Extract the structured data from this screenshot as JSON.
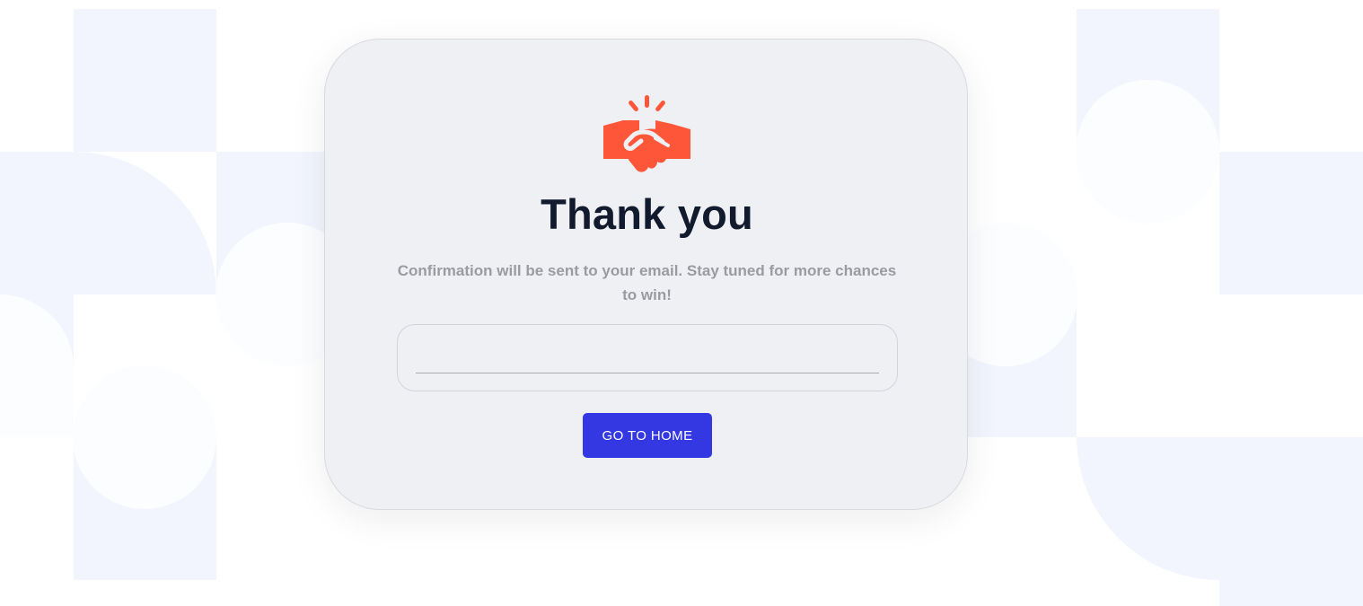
{
  "colors": {
    "background": "#ffffff",
    "pattern": "#f2f5fd",
    "card": "#eff0f4",
    "accent_icon": "#fe5638",
    "title": "#121a2e",
    "subtitle": "#9a9ba1",
    "button": "#3338e3",
    "button_text": "#ffffff"
  },
  "icon": {
    "name": "handshake-icon"
  },
  "card": {
    "title": "Thank you",
    "message": "Confirmation will be sent to your email. Stay tuned for more chances to win!",
    "input": {
      "value": "",
      "placeholder": ""
    },
    "button_label": "GO TO HOME"
  }
}
